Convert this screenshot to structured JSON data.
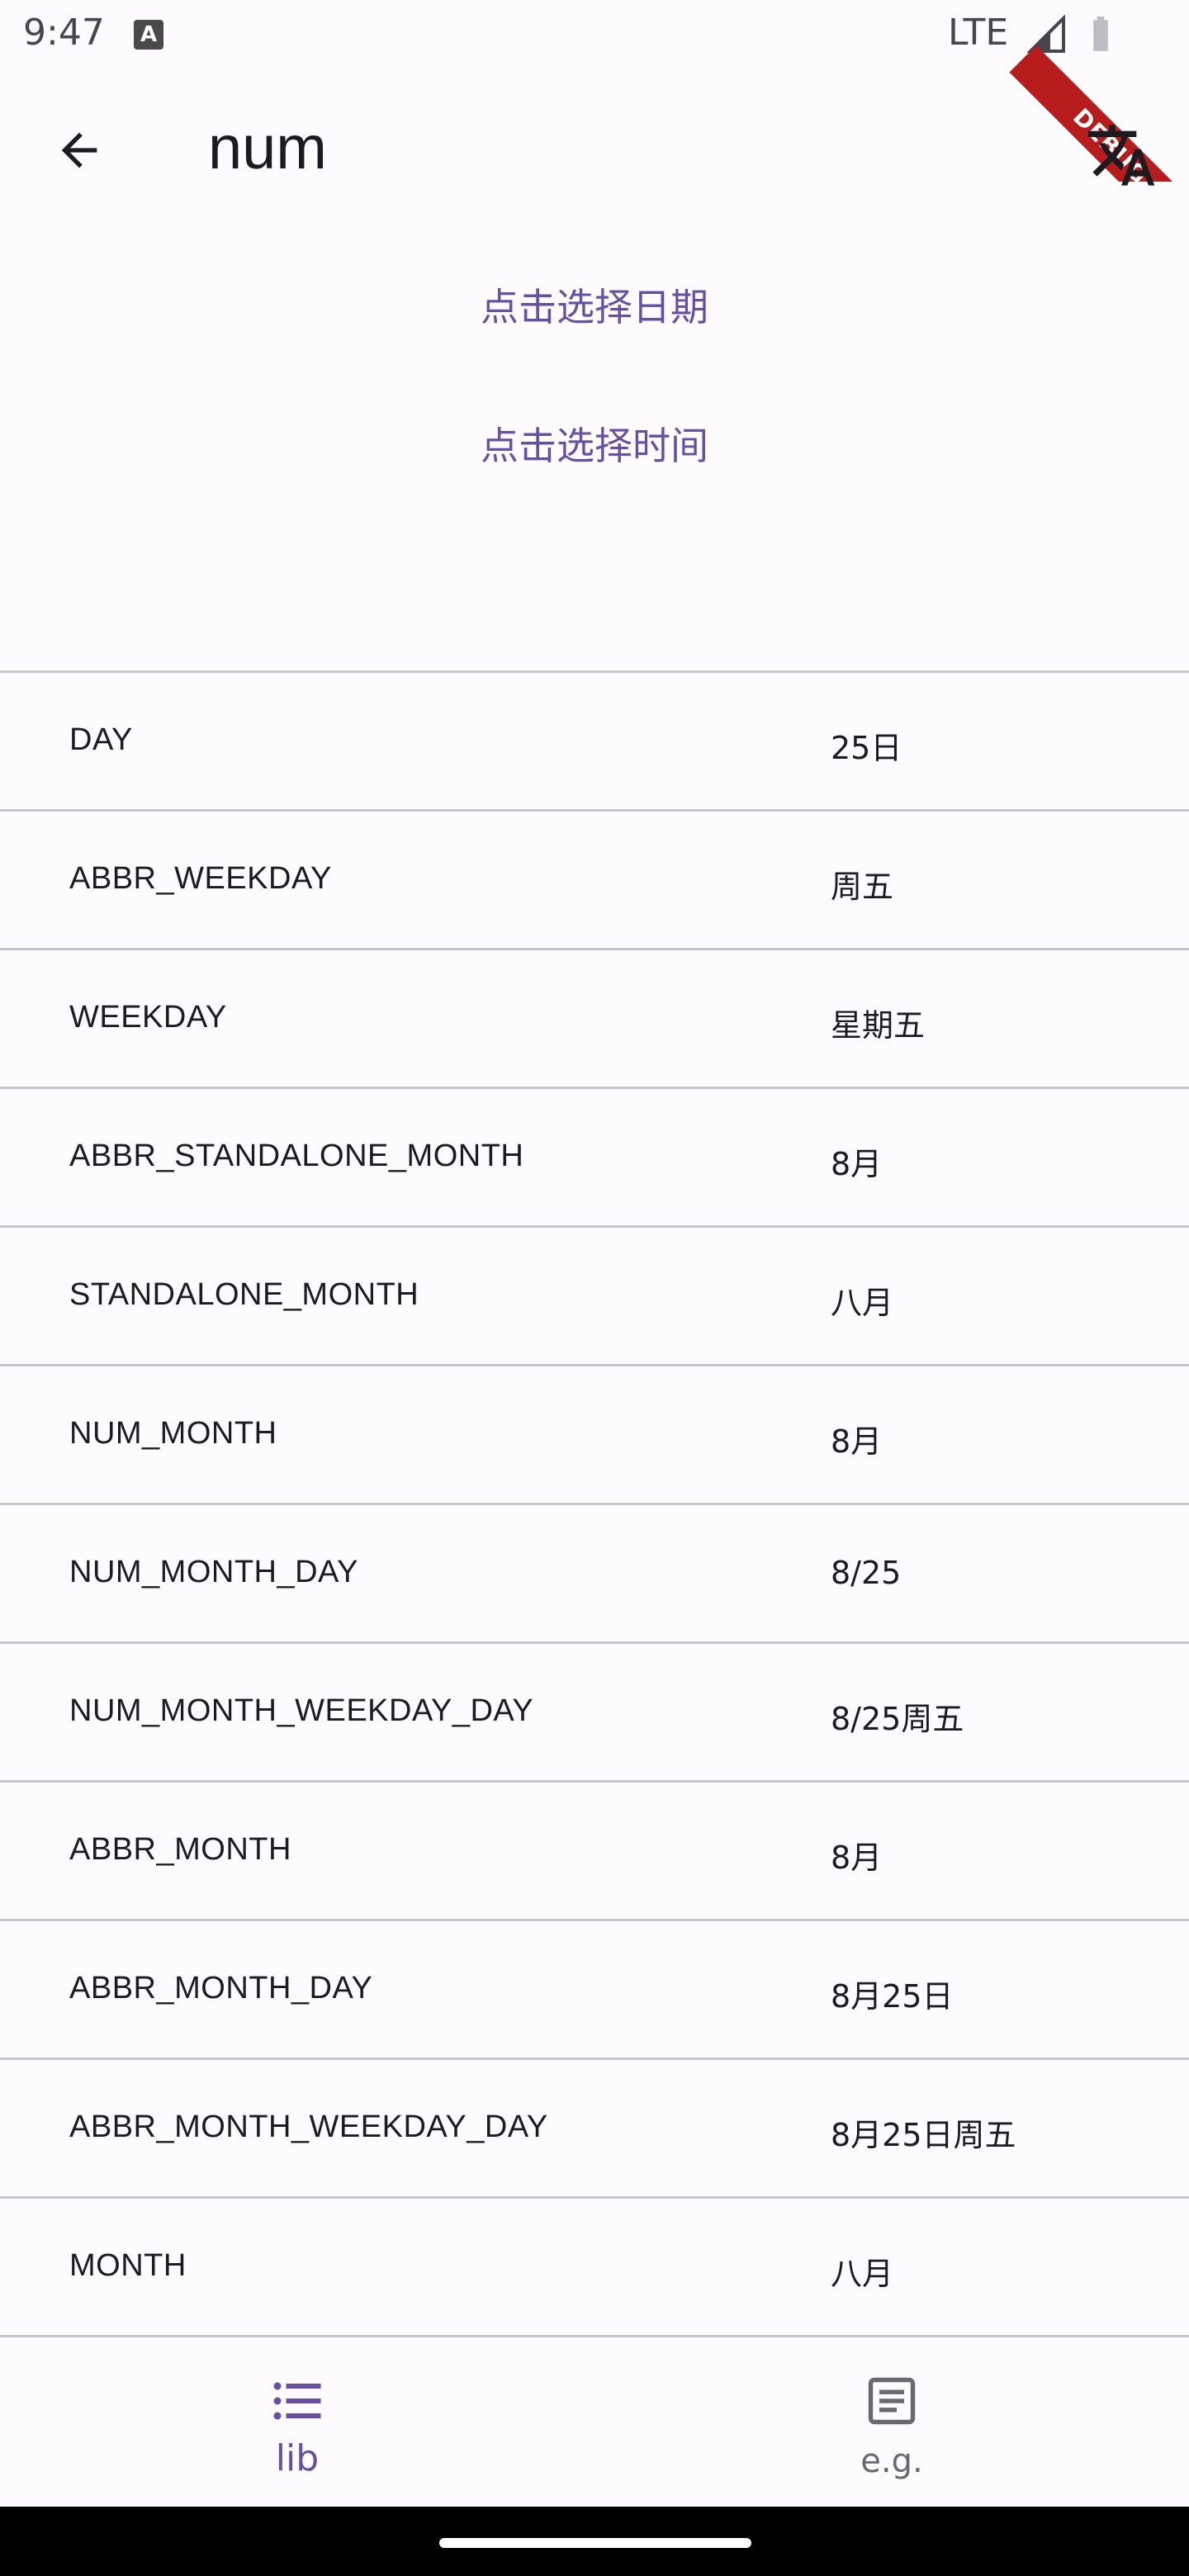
{
  "status_bar": {
    "time": "9:47",
    "notification_letter": "A",
    "network": "LTE"
  },
  "debug_banner": "DEBUG",
  "app_bar": {
    "title": "num"
  },
  "actions": {
    "pick_date": "点击选择日期",
    "pick_time": "点击选择时间"
  },
  "rows": [
    {
      "key": "DAY",
      "value": "25日"
    },
    {
      "key": "ABBR_WEEKDAY",
      "value": "周五"
    },
    {
      "key": "WEEKDAY",
      "value": "星期五"
    },
    {
      "key": "ABBR_STANDALONE_MONTH",
      "value": "8月"
    },
    {
      "key": "STANDALONE_MONTH",
      "value": "八月"
    },
    {
      "key": "NUM_MONTH",
      "value": "8月"
    },
    {
      "key": "NUM_MONTH_DAY",
      "value": "8/25"
    },
    {
      "key": "NUM_MONTH_WEEKDAY_DAY",
      "value": "8/25周五"
    },
    {
      "key": "ABBR_MONTH",
      "value": "8月"
    },
    {
      "key": "ABBR_MONTH_DAY",
      "value": "8月25日"
    },
    {
      "key": "ABBR_MONTH_WEEKDAY_DAY",
      "value": "8月25日周五"
    },
    {
      "key": "MONTH",
      "value": "八月"
    }
  ],
  "bottom_nav": {
    "items": [
      {
        "label": "lib",
        "icon": "list-icon",
        "selected": true
      },
      {
        "label": "e.g.",
        "icon": "article-icon",
        "selected": false
      }
    ]
  },
  "colors": {
    "accent": "#6750a4",
    "background": "#fefbff",
    "divider": "#cac4d0",
    "debug": "#b71c1c"
  }
}
